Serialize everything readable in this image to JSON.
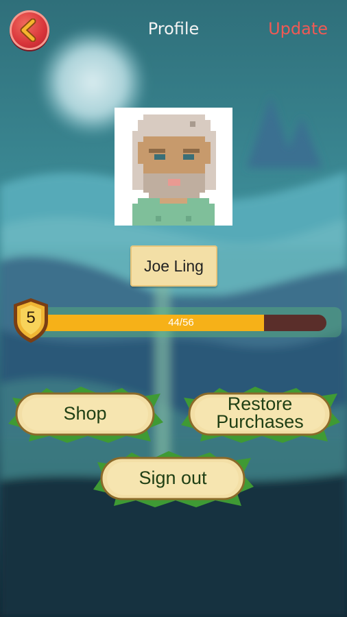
{
  "header": {
    "back_icon": "chevron-left-icon",
    "title": "Profile",
    "update_label": "Update"
  },
  "profile": {
    "name": "Joe Ling",
    "avatar": "pixel-avatar-icon",
    "level": "5",
    "xp_text": "44/56",
    "xp_fraction": 0.786
  },
  "buttons": {
    "shop": "Shop",
    "restore_line1": "Restore",
    "restore_line2": "Purchases",
    "sign_out": "Sign out"
  },
  "colors": {
    "accent_red": "#ef5a55",
    "xp_fill": "#f6b118",
    "parchment": "#f3dfa6",
    "leaf_green": "#3f9a34"
  }
}
